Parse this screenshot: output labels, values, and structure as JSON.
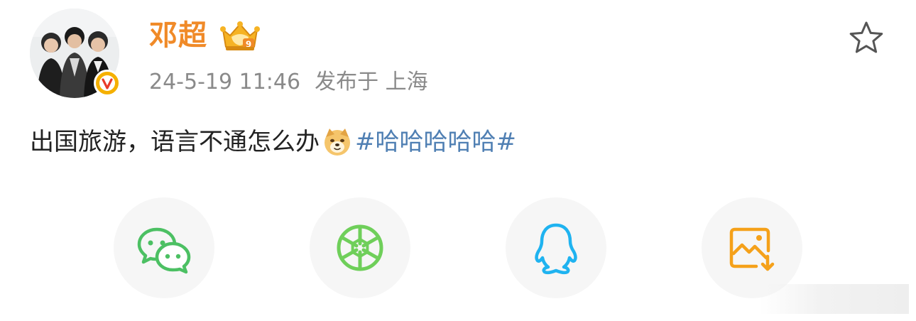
{
  "post": {
    "username": "邓超",
    "date": "24-5-19 11:46",
    "location": "发布于 上海",
    "text": "出国旅游，语言不通怎么办",
    "hashtag": "#哈哈哈哈哈#"
  },
  "icons": {
    "avatar": "user-avatar-photo",
    "verified": "verified-v-badge",
    "vip": "vip-crown-badge",
    "favorite": "star-icon",
    "emoji": "doge-emoji"
  },
  "share": [
    {
      "name": "wechat",
      "icon": "wechat-icon"
    },
    {
      "name": "moments",
      "icon": "moments-icon"
    },
    {
      "name": "qq",
      "icon": "qq-icon"
    },
    {
      "name": "save-image",
      "icon": "save-image-icon"
    }
  ],
  "colors": {
    "username": "#f08a28",
    "meta": "#8a8a8a",
    "hashtag": "#4f7fb3",
    "wechat": "#4cc063",
    "moments": "#6fcf5a",
    "qq": "#1fb3f0",
    "save": "#f5a11a"
  }
}
